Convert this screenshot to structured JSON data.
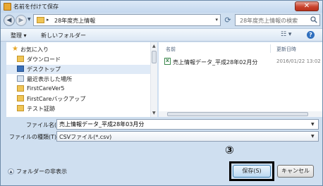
{
  "window": {
    "title": "名前を付けて保存",
    "close_label": "✕"
  },
  "address": {
    "path_segment": "28年度売上情報",
    "arrow": "▸",
    "dropdown": "▾"
  },
  "search": {
    "placeholder": "28年度売上情報の検索"
  },
  "toolbar": {
    "organize_label": "整理 ▾",
    "new_folder_label": "新しいフォルダー",
    "view_label": "☷ ▾",
    "help_label": "?"
  },
  "sidebar": {
    "items": [
      {
        "label": "お気に入り",
        "icon": "star-icon"
      },
      {
        "label": "ダウンロード",
        "icon": "folder-icon"
      },
      {
        "label": "デスクトップ",
        "icon": "desktop-icon"
      },
      {
        "label": "最近表示した場所",
        "icon": "recent-places-icon"
      },
      {
        "label": "FirstCareVer5",
        "icon": "folder-icon"
      },
      {
        "label": "FirstCareバックアップ",
        "icon": "folder-icon"
      },
      {
        "label": "テスト証跡",
        "icon": "folder-icon"
      }
    ]
  },
  "files": {
    "col_name": "名前",
    "col_date": "更新日時",
    "rows": [
      {
        "name": "売上情報データ_平成28年02月分",
        "date": "2016/01/22 13:02",
        "icon": "excel-csv-icon"
      }
    ]
  },
  "form": {
    "filename_label": "ファイル名(N):",
    "filename_value": "売上情報データ_平成28年03月分",
    "filetype_label": "ファイルの種類(T):",
    "filetype_value": "CSVファイル(*.csv)"
  },
  "footer": {
    "hide_folders_label": "フォルダーの非表示",
    "annotation_number": "③",
    "save_label": "保存(S)",
    "cancel_label": "キャンセル"
  },
  "colors": {
    "annotation_border": "#000000",
    "save_button": "#bcd9f2",
    "close_button": "#c9432d"
  }
}
